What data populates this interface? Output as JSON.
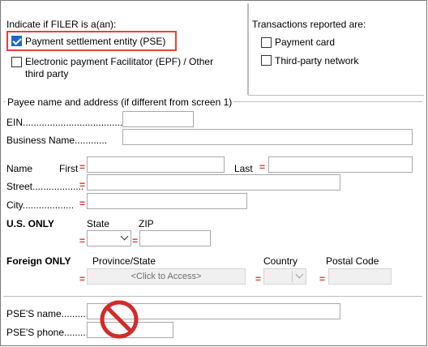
{
  "filer": {
    "legend": "Indicate if FILER is a(an):",
    "pse_label": "Payment settlement entity (PSE)",
    "pse_checked": true,
    "epf_label_line1": "Electronic payment Facilitator (EPF) / Other",
    "epf_label_line2": "third party",
    "epf_checked": false
  },
  "transactions": {
    "legend": "Transactions reported are:",
    "payment_card_label": "Payment card",
    "payment_card_checked": false,
    "third_party_label": "Third-party network",
    "third_party_checked": false
  },
  "payee": {
    "legend": "Payee name and address (if different from screen 1)",
    "ein_label": "EIN.....................................",
    "ein_value": "",
    "business_label": "Business Name............",
    "business_value": "",
    "name_label": "Name",
    "first_label": "First",
    "first_value": "",
    "last_label": "Last",
    "last_value": "",
    "street_label": "Street...................",
    "street_value": "",
    "city_label": "City...................",
    "city_value": "",
    "us_only_label": "U.S. ONLY",
    "state_label": "State",
    "state_value": "",
    "zip_label": "ZIP",
    "zip_value": "",
    "foreign_only_label": "Foreign ONLY",
    "province_label": "Province/State",
    "province_placeholder": "<Click to Access>",
    "country_label": "Country",
    "country_value": "",
    "postal_label": "Postal Code",
    "postal_value": ""
  },
  "pse": {
    "name_label": "PSE'S name..........",
    "name_value": "",
    "phone_label": "PSE'S phone.........",
    "phone_value": ""
  },
  "required_marker": "=",
  "colors": {
    "highlight": "#e8413a",
    "required": "#e03030",
    "check_blue": "#1f66c6",
    "no_sign_red": "#d42a2a"
  },
  "icons": {
    "no_sign": "prohibited-sign-icon"
  }
}
